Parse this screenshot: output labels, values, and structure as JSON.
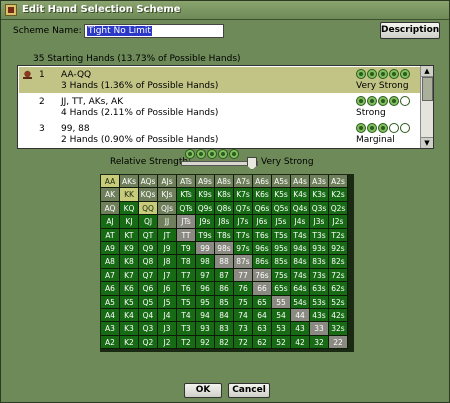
{
  "window": {
    "title": "Edit Hand Selection Scheme"
  },
  "scheme": {
    "label": "Scheme Name:",
    "value": "Tight No Limit"
  },
  "buttons": {
    "description": "Description",
    "ok": "OK",
    "cancel": "Cancel"
  },
  "summary": "35 Starting Hands  (13.73% of Possible Hands)",
  "groups": [
    {
      "num": "1",
      "hands": "AA-QQ",
      "desc": "3 Hands  (1.36% of Possible Hands)",
      "strength_label": "Very Strong",
      "strength": 5,
      "selected": true
    },
    {
      "num": "2",
      "hands": "JJ, TT, AKs, AK",
      "desc": "4 Hands  (2.11% of Possible Hands)",
      "strength_label": "Strong",
      "strength": 4,
      "selected": false
    },
    {
      "num": "3",
      "hands": "99, 88",
      "desc": "2 Hands  (0.90% of Possible Hands)",
      "strength_label": "Marginal",
      "strength": 3,
      "selected": false
    }
  ],
  "relative_strength": {
    "label": "Relative Strength:",
    "value_label": "Very Strong",
    "level": 5,
    "max": 5
  },
  "matrix": [
    [
      [
        "AA",
        1
      ],
      [
        "AKs",
        2
      ],
      [
        "AQs",
        2
      ],
      [
        "AJs",
        2
      ],
      [
        "ATs",
        2
      ],
      [
        "A9s",
        2
      ],
      [
        "A8s",
        2
      ],
      [
        "A7s",
        2
      ],
      [
        "A6s",
        2
      ],
      [
        "A5s",
        2
      ],
      [
        "A4s",
        2
      ],
      [
        "A3s",
        2
      ],
      [
        "A2s",
        2
      ]
    ],
    [
      [
        "AK",
        2
      ],
      [
        "KK",
        1
      ],
      [
        "KQs",
        2
      ],
      [
        "KJs",
        2
      ],
      [
        "KTs",
        0
      ],
      [
        "K9s",
        0
      ],
      [
        "K8s",
        0
      ],
      [
        "K7s",
        0
      ],
      [
        "K6s",
        0
      ],
      [
        "K5s",
        0
      ],
      [
        "K4s",
        0
      ],
      [
        "K3s",
        0
      ],
      [
        "K2s",
        0
      ]
    ],
    [
      [
        "AQ",
        2
      ],
      [
        "KQ",
        0
      ],
      [
        "QQ",
        1
      ],
      [
        "QJs",
        2
      ],
      [
        "QTs",
        0
      ],
      [
        "Q9s",
        0
      ],
      [
        "Q8s",
        0
      ],
      [
        "Q7s",
        0
      ],
      [
        "Q6s",
        0
      ],
      [
        "Q5s",
        0
      ],
      [
        "Q4s",
        0
      ],
      [
        "Q3s",
        0
      ],
      [
        "Q2s",
        0
      ]
    ],
    [
      [
        "AJ",
        0
      ],
      [
        "KJ",
        0
      ],
      [
        "QJ",
        0
      ],
      [
        "JJ",
        2
      ],
      [
        "JTs",
        3
      ],
      [
        "J9s",
        0
      ],
      [
        "J8s",
        0
      ],
      [
        "J7s",
        0
      ],
      [
        "J6s",
        0
      ],
      [
        "J5s",
        0
      ],
      [
        "J4s",
        0
      ],
      [
        "J3s",
        0
      ],
      [
        "J2s",
        0
      ]
    ],
    [
      [
        "AT",
        0
      ],
      [
        "KT",
        0
      ],
      [
        "QT",
        0
      ],
      [
        "JT",
        0
      ],
      [
        "TT",
        3
      ],
      [
        "T9s",
        0
      ],
      [
        "T8s",
        0
      ],
      [
        "T7s",
        0
      ],
      [
        "T6s",
        0
      ],
      [
        "T5s",
        0
      ],
      [
        "T4s",
        0
      ],
      [
        "T3s",
        0
      ],
      [
        "T2s",
        0
      ]
    ],
    [
      [
        "A9",
        0
      ],
      [
        "K9",
        0
      ],
      [
        "Q9",
        0
      ],
      [
        "J9",
        0
      ],
      [
        "T9",
        0
      ],
      [
        "99",
        3
      ],
      [
        "98s",
        3
      ],
      [
        "97s",
        0
      ],
      [
        "96s",
        0
      ],
      [
        "95s",
        0
      ],
      [
        "94s",
        0
      ],
      [
        "93s",
        0
      ],
      [
        "92s",
        0
      ]
    ],
    [
      [
        "A8",
        0
      ],
      [
        "K8",
        0
      ],
      [
        "Q8",
        0
      ],
      [
        "J8",
        0
      ],
      [
        "T8",
        0
      ],
      [
        "98",
        0
      ],
      [
        "88",
        3
      ],
      [
        "87s",
        3
      ],
      [
        "86s",
        0
      ],
      [
        "85s",
        0
      ],
      [
        "84s",
        0
      ],
      [
        "83s",
        0
      ],
      [
        "82s",
        0
      ]
    ],
    [
      [
        "A7",
        0
      ],
      [
        "K7",
        0
      ],
      [
        "Q7",
        0
      ],
      [
        "J7",
        0
      ],
      [
        "T7",
        0
      ],
      [
        "97",
        0
      ],
      [
        "87",
        0
      ],
      [
        "77",
        3
      ],
      [
        "76s",
        3
      ],
      [
        "75s",
        0
      ],
      [
        "74s",
        0
      ],
      [
        "73s",
        0
      ],
      [
        "72s",
        0
      ]
    ],
    [
      [
        "A6",
        0
      ],
      [
        "K6",
        0
      ],
      [
        "Q6",
        0
      ],
      [
        "J6",
        0
      ],
      [
        "T6",
        0
      ],
      [
        "96",
        0
      ],
      [
        "86",
        0
      ],
      [
        "76",
        0
      ],
      [
        "66",
        3
      ],
      [
        "65s",
        0
      ],
      [
        "64s",
        0
      ],
      [
        "63s",
        0
      ],
      [
        "62s",
        0
      ]
    ],
    [
      [
        "A5",
        0
      ],
      [
        "K5",
        0
      ],
      [
        "Q5",
        0
      ],
      [
        "J5",
        0
      ],
      [
        "T5",
        0
      ],
      [
        "95",
        0
      ],
      [
        "85",
        0
      ],
      [
        "75",
        0
      ],
      [
        "65",
        0
      ],
      [
        "55",
        3
      ],
      [
        "54s",
        0
      ],
      [
        "53s",
        0
      ],
      [
        "52s",
        0
      ]
    ],
    [
      [
        "A4",
        0
      ],
      [
        "K4",
        0
      ],
      [
        "Q4",
        0
      ],
      [
        "J4",
        0
      ],
      [
        "T4",
        0
      ],
      [
        "94",
        0
      ],
      [
        "84",
        0
      ],
      [
        "74",
        0
      ],
      [
        "64",
        0
      ],
      [
        "54",
        0
      ],
      [
        "44",
        3
      ],
      [
        "43s",
        0
      ],
      [
        "42s",
        0
      ]
    ],
    [
      [
        "A3",
        0
      ],
      [
        "K3",
        0
      ],
      [
        "Q3",
        0
      ],
      [
        "J3",
        0
      ],
      [
        "T3",
        0
      ],
      [
        "93",
        0
      ],
      [
        "83",
        0
      ],
      [
        "73",
        0
      ],
      [
        "63",
        0
      ],
      [
        "53",
        0
      ],
      [
        "43",
        0
      ],
      [
        "33",
        3
      ],
      [
        "32s",
        0
      ]
    ],
    [
      [
        "A2",
        0
      ],
      [
        "K2",
        0
      ],
      [
        "Q2",
        0
      ],
      [
        "J2",
        0
      ],
      [
        "T2",
        0
      ],
      [
        "92",
        0
      ],
      [
        "82",
        0
      ],
      [
        "72",
        0
      ],
      [
        "62",
        0
      ],
      [
        "52",
        0
      ],
      [
        "42",
        0
      ],
      [
        "32",
        0
      ],
      [
        "22",
        3
      ]
    ]
  ]
}
